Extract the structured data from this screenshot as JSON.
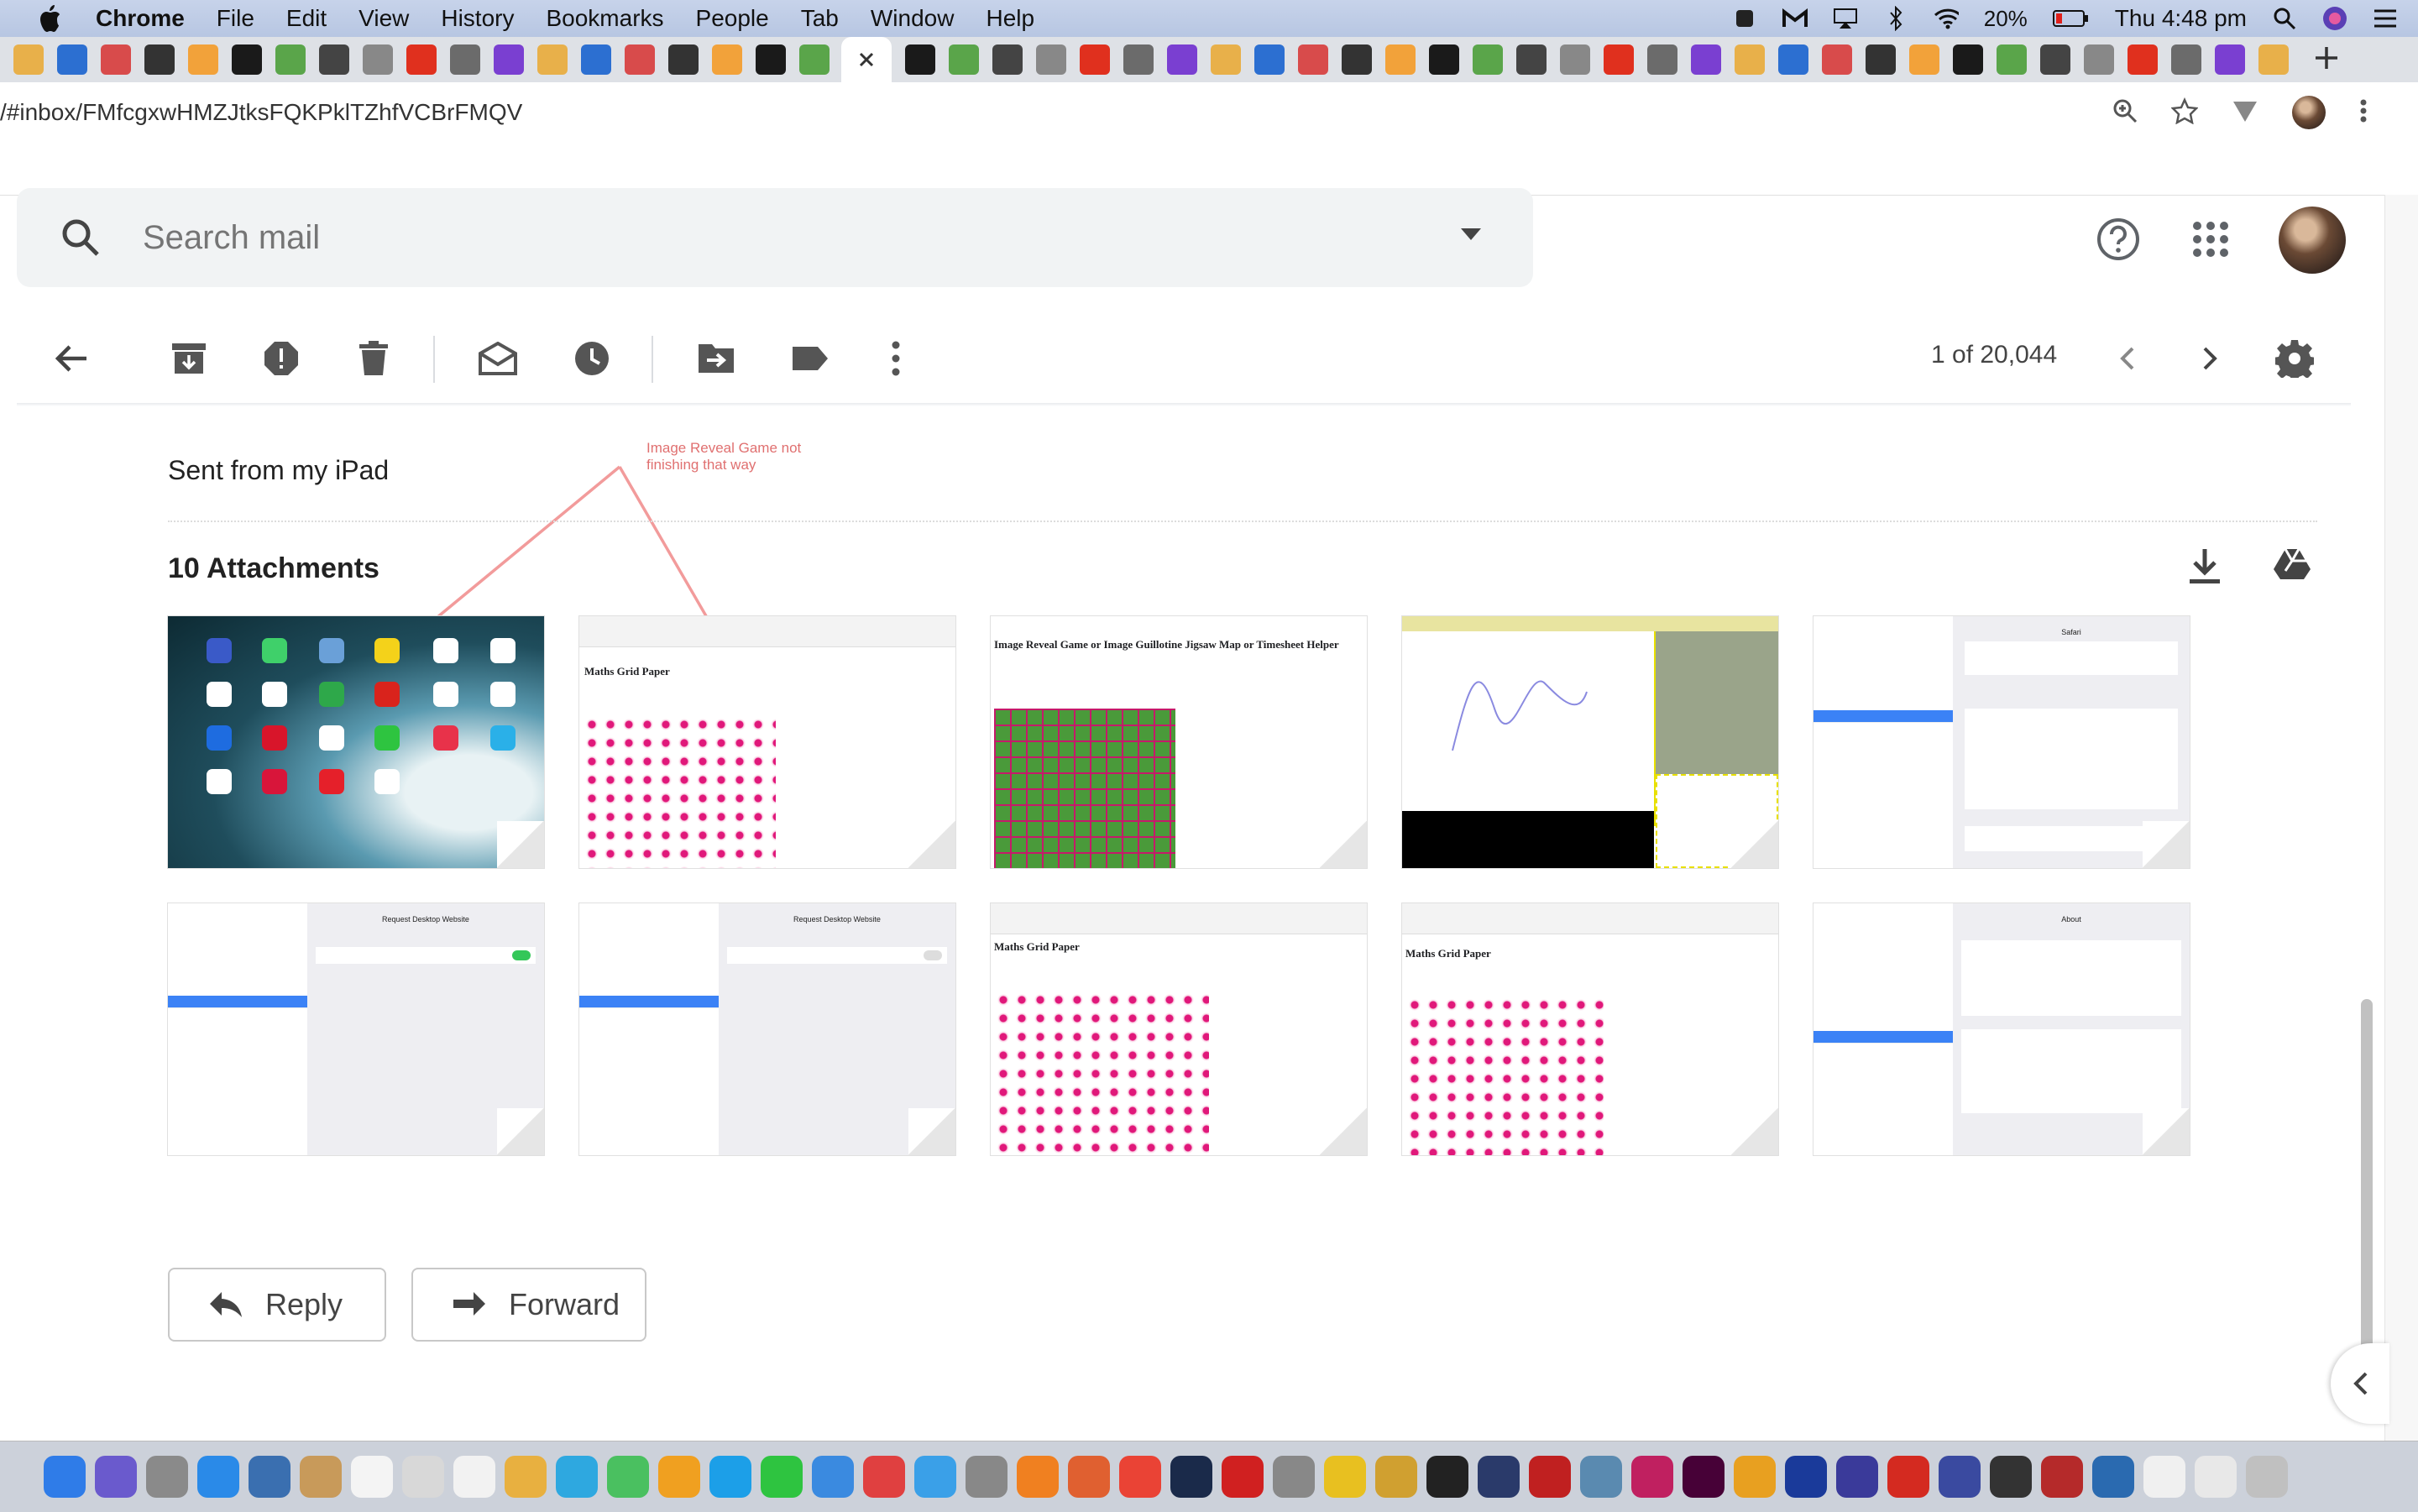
{
  "menubar": {
    "app": "Chrome",
    "menus": [
      "File",
      "Edit",
      "View",
      "History",
      "Bookmarks",
      "People",
      "Tab",
      "Window",
      "Help"
    ],
    "battery": "20%",
    "clock": "Thu 4:48 pm"
  },
  "browser": {
    "url": "/#inbox/FMfcgxwHMZJtksFQKPklTZhfVCBrFMQV",
    "tab_count_before_active": 19,
    "tab_count_after_active": 32
  },
  "search": {
    "placeholder": "Search mail"
  },
  "toolbar": {
    "pager": "1 of 20,044"
  },
  "message": {
    "body_text": "Sent from my iPad",
    "annotation": "Image Reveal Game not finishing that way",
    "attachments_title": "10 Attachments"
  },
  "attachments": [
    {
      "kind": "ipad-home"
    },
    {
      "kind": "grid-paper",
      "heading": "Maths Grid Paper"
    },
    {
      "kind": "green-grid",
      "heading": "Image Reveal Game or Image Guillotine Jigsaw Map or Timesheet Helper"
    },
    {
      "kind": "drawing"
    },
    {
      "kind": "settings-safari",
      "panel_title": "Safari"
    },
    {
      "kind": "settings-desktop",
      "panel_title": "Request Desktop Website"
    },
    {
      "kind": "settings-desktop-off",
      "panel_title": "Request Desktop Website"
    },
    {
      "kind": "grid-paper",
      "heading": "Maths Grid Paper"
    },
    {
      "kind": "grid-paper",
      "heading": "Maths Grid Paper"
    },
    {
      "kind": "settings-about",
      "panel_title": "About"
    }
  ],
  "actions": {
    "reply": "Reply",
    "forward": "Forward"
  },
  "colors": {
    "annotation": "#e07070",
    "grid_dot": "#e0187a",
    "green_grid": "#4a9a3a"
  }
}
